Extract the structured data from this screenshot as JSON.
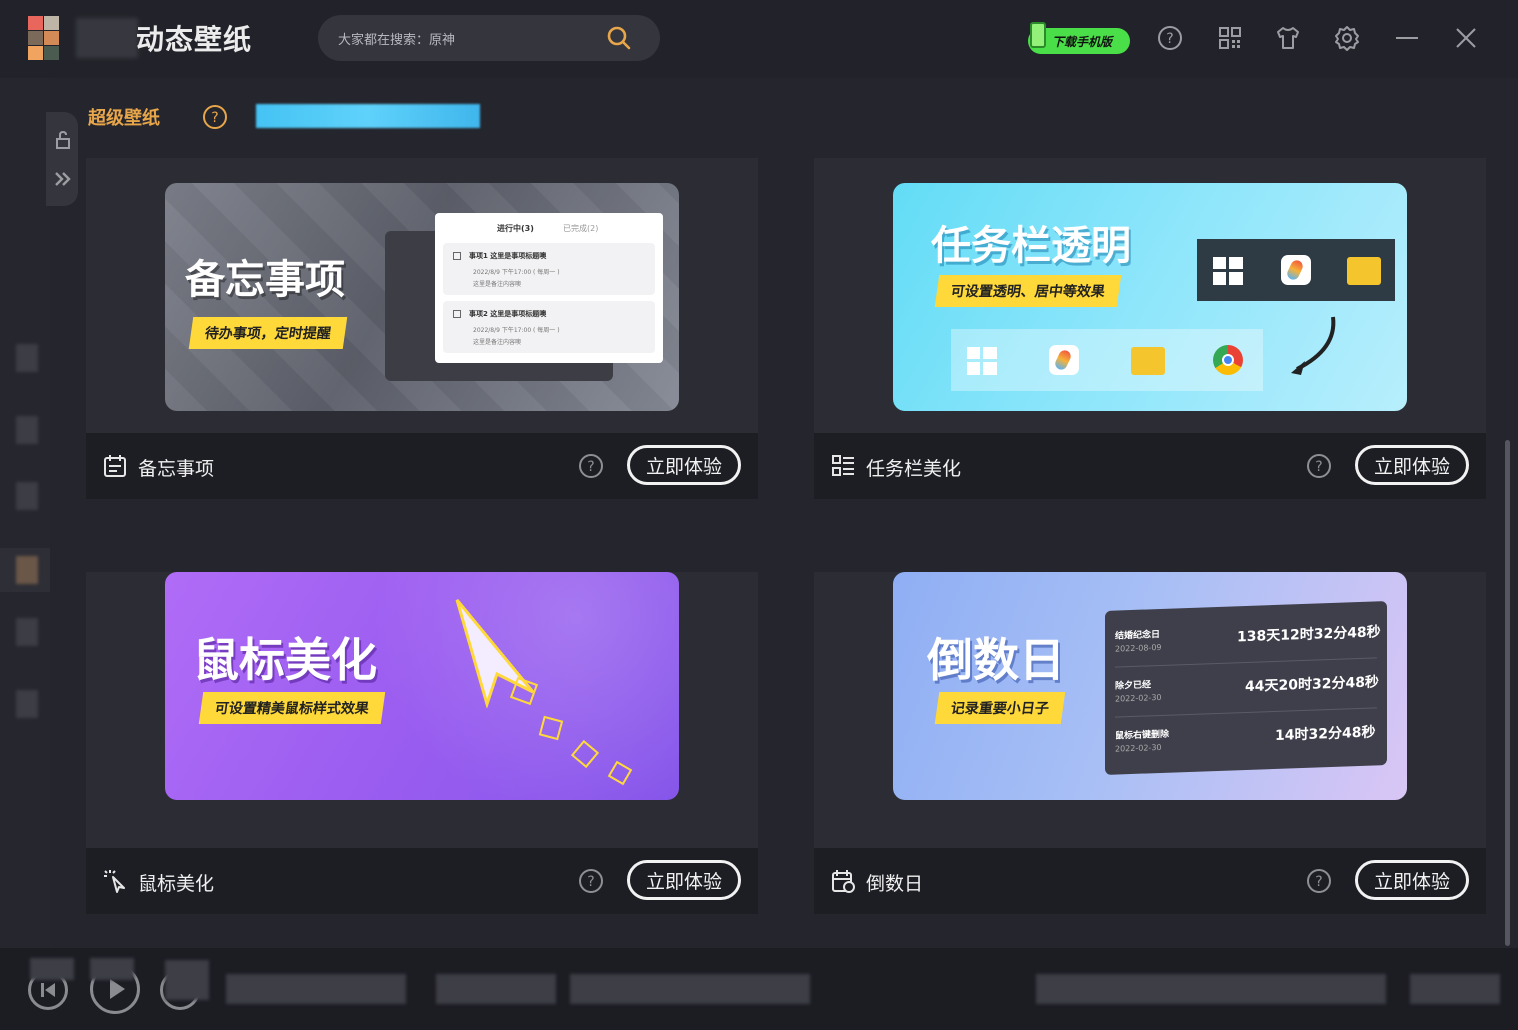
{
  "app": {
    "title": "动态壁纸"
  },
  "search": {
    "placeholder": "大家都在搜索：原神"
  },
  "toolbar": {
    "mobile_label": "下载手机版"
  },
  "section": {
    "title": "超级壁纸"
  },
  "cards": [
    {
      "name": "备忘事项",
      "button": "立即体验",
      "banner": {
        "headline": "备忘事项",
        "tag": "待办事项，定时提醒",
        "tab_active": "进行中(3)",
        "tab_done": "已完成(2)",
        "items": [
          {
            "title": "事项1 这里是事项标题噢",
            "time": "2022/8/9 下午17:00 ( 每周一 )",
            "note": "这里是备注内容噢"
          },
          {
            "title": "事项2 这里是事项标题噢",
            "time": "2022/8/9 下午17:00 ( 每周一 )",
            "note": "这里是备注内容噢"
          }
        ]
      }
    },
    {
      "name": "任务栏美化",
      "button": "立即体验",
      "banner": {
        "headline": "任务栏透明",
        "tag": "可设置透明、居中等效果"
      }
    },
    {
      "name": "鼠标美化",
      "button": "立即体验",
      "banner": {
        "headline": "鼠标美化",
        "tag": "可设置精美鼠标样式效果"
      }
    },
    {
      "name": "倒数日",
      "button": "立即体验",
      "banner": {
        "headline": "倒数日",
        "tag": "记录重要小日子",
        "rows": [
          {
            "label": "结婚纪念日",
            "date": "2022-08-09",
            "value": "138天12时32分48秒"
          },
          {
            "label": "除夕已经",
            "date": "2022-02-30",
            "value": "44天20时32分48秒"
          },
          {
            "label": "鼠标右键删除",
            "date": "2022-02-30",
            "value": "14时32分48秒"
          }
        ]
      }
    }
  ],
  "colors": {
    "accent": "#e8a64a",
    "bg": "#24252d",
    "card": "#2c2d34",
    "footer": "#1d1e24"
  }
}
